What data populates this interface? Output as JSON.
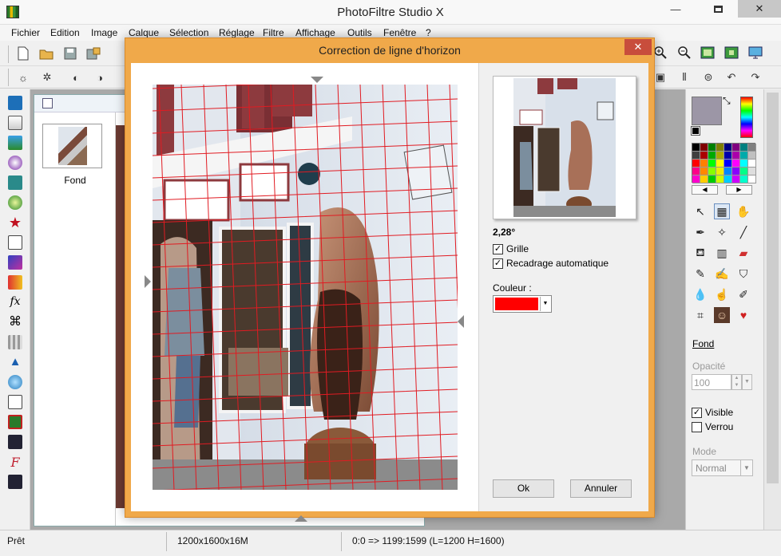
{
  "app": {
    "title": "PhotoFiltre Studio X"
  },
  "menu": [
    "Fichier",
    "Edition",
    "Image",
    "Calque",
    "Sélection",
    "Réglage",
    "Filtre",
    "Affichage",
    "Outils",
    "Fenêtre",
    "?"
  ],
  "document": {
    "layer_name": "Fond"
  },
  "layers_panel": {
    "layer_link": "Fond",
    "opacity_label": "Opacité",
    "opacity_value": "100",
    "visible_label": "Visible",
    "lock_label": "Verrou",
    "mode_label": "Mode",
    "mode_value": "Normal"
  },
  "status": {
    "ready": "Prêt",
    "image_info": "1200x1600x16M",
    "coords": "0:0 => 1199:1599 (L=1200  H=1600)"
  },
  "dialog": {
    "title": "Correction de ligne d'horizon",
    "angle": "2,28°",
    "grid_label": "Grille",
    "grid_checked": true,
    "autocrop_label": "Recadrage automatique",
    "autocrop_checked": true,
    "color_label": "Couleur :",
    "color_value": "#ff0000",
    "ok_label": "Ok",
    "cancel_label": "Annuler"
  },
  "colors": {
    "grid": "#e11b22",
    "dialog_frame": "#f0a94a",
    "foreground": "#9c96a6"
  }
}
